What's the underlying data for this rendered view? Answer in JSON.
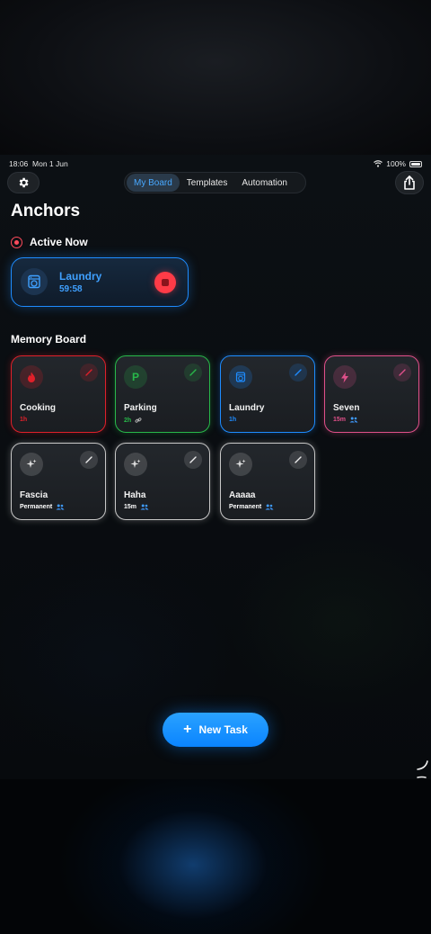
{
  "status": {
    "time": "18:06",
    "date": "Mon 1 Jun",
    "battery": "100%"
  },
  "nav": {
    "tabs": [
      {
        "label": "My Board",
        "active": true
      },
      {
        "label": "Templates",
        "active": false
      },
      {
        "label": "Automation",
        "active": false
      }
    ]
  },
  "page": {
    "title": "Anchors"
  },
  "active_now": {
    "heading": "Active Now",
    "task": {
      "name": "Laundry",
      "timer": "59:58",
      "color": "#3fa0ff",
      "icon": "washing-machine-icon"
    }
  },
  "memory_board": {
    "heading": "Memory Board",
    "tiles": [
      {
        "name": "Cooking",
        "meta": "1h",
        "accent": "#e0202a",
        "icon": "flame-icon",
        "glyph": "",
        "extra": ""
      },
      {
        "name": "Parking",
        "meta": "2h",
        "accent": "#28b84a",
        "icon": "parking-icon",
        "glyph": "P",
        "extra": "link-icon"
      },
      {
        "name": "Laundry",
        "meta": "1h",
        "accent": "#1e8cff",
        "icon": "washing-machine-icon",
        "glyph": "",
        "extra": ""
      },
      {
        "name": "Seven",
        "meta": "15m",
        "accent": "#e0508a",
        "icon": "bolt-icon",
        "glyph": "",
        "extra": "people-icon"
      },
      {
        "name": "Fascia",
        "meta": "Permanent",
        "accent": "#c8c8c8",
        "icon": "sparkles-icon",
        "glyph": "",
        "extra": "people-icon"
      },
      {
        "name": "Haha",
        "meta": "15m",
        "accent": "#c8c8c8",
        "icon": "sparkles-icon",
        "glyph": "",
        "extra": "people-icon"
      },
      {
        "name": "Aaaaa",
        "meta": "Permanent",
        "accent": "#c8c8c8",
        "icon": "sparkles-icon",
        "glyph": "",
        "extra": "people-icon"
      }
    ]
  },
  "new_task": {
    "label": "New Task"
  }
}
